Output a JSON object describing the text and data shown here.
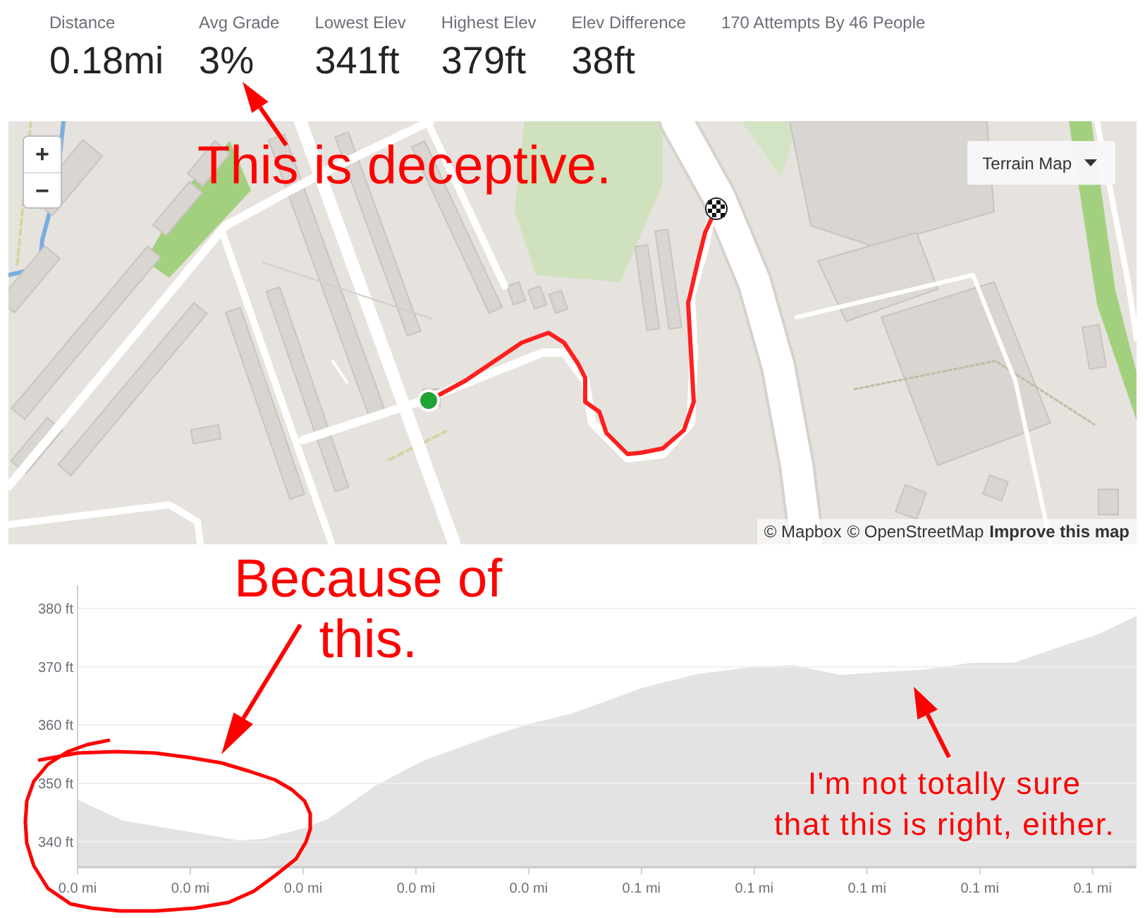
{
  "stats": [
    {
      "label": "Distance",
      "value": "0.18mi"
    },
    {
      "label": "Avg Grade",
      "value": "3%"
    },
    {
      "label": "Lowest Elev",
      "value": "341ft"
    },
    {
      "label": "Highest Elev",
      "value": "379ft"
    },
    {
      "label": "Elev Difference",
      "value": "38ft"
    }
  ],
  "attempts": "170 Attempts By 46 People",
  "map": {
    "zoom_buttons": [
      {
        "label": "+"
      },
      {
        "label": "−"
      }
    ],
    "layer_menu": {
      "label": "Terrain Map"
    },
    "attribution": [
      {
        "label": "© Mapbox",
        "emphasized": false
      },
      {
        "label": "© OpenStreetMap",
        "emphasized": false
      },
      {
        "label": "Improve this map",
        "emphasized": true
      }
    ]
  },
  "elevation_chart": {
    "chart_data": {
      "type": "area",
      "x": [
        0,
        0.004,
        0.0098,
        0.0144,
        0.0165,
        0.0203,
        0.0223,
        0.0265,
        0.0306,
        0.0365,
        0.0403,
        0.0439,
        0.0501,
        0.0551,
        0.0601,
        0.0635,
        0.0676,
        0.0705,
        0.0751,
        0.0793,
        0.083,
        0.0868,
        0.0905,
        0.0939
      ],
      "series": [
        {
          "color": "#e3e3e3",
          "values": [
            347.2,
            343.6,
            341.7,
            340.2,
            340.5,
            342.4,
            344.0,
            349.7,
            353.8,
            358.0,
            360.3,
            362.0,
            366.4,
            368.8,
            370.0,
            370.3,
            368.6,
            369.0,
            369.5,
            370.7,
            370.7,
            373.2,
            375.6,
            378.7
          ]
        }
      ],
      "xlim": [
        0,
        0.0939
      ],
      "ylim": [
        335.6,
        384
      ],
      "xticks": [
        {
          "value": 0,
          "label": "0.0 mi"
        },
        {
          "value": 0.01,
          "label": "0.0 mi"
        },
        {
          "value": 0.02,
          "label": "0.0 mi"
        },
        {
          "value": 0.03,
          "label": "0.0 mi"
        },
        {
          "value": 0.04,
          "label": "0.0 mi"
        },
        {
          "value": 0.05,
          "label": "0.1 mi"
        },
        {
          "value": 0.06,
          "label": "0.1 mi"
        },
        {
          "value": 0.07,
          "label": "0.1 mi"
        },
        {
          "value": 0.08,
          "label": "0.1 mi"
        },
        {
          "value": 0.09,
          "label": "0.1 mi"
        }
      ],
      "yticks": [
        {
          "value": 340,
          "label": "340 ft"
        },
        {
          "value": 350,
          "label": "350 ft"
        },
        {
          "value": 360,
          "label": "360 ft"
        },
        {
          "value": 370,
          "label": "370 ft"
        },
        {
          "value": 380,
          "label": "380 ft"
        }
      ],
      "grid": true
    }
  },
  "annotations": [
    {
      "text": "This is deceptive."
    },
    {
      "text": "Because of\nthis."
    },
    {
      "text": "I'm not totally sure\nthat this is right, either."
    }
  ]
}
